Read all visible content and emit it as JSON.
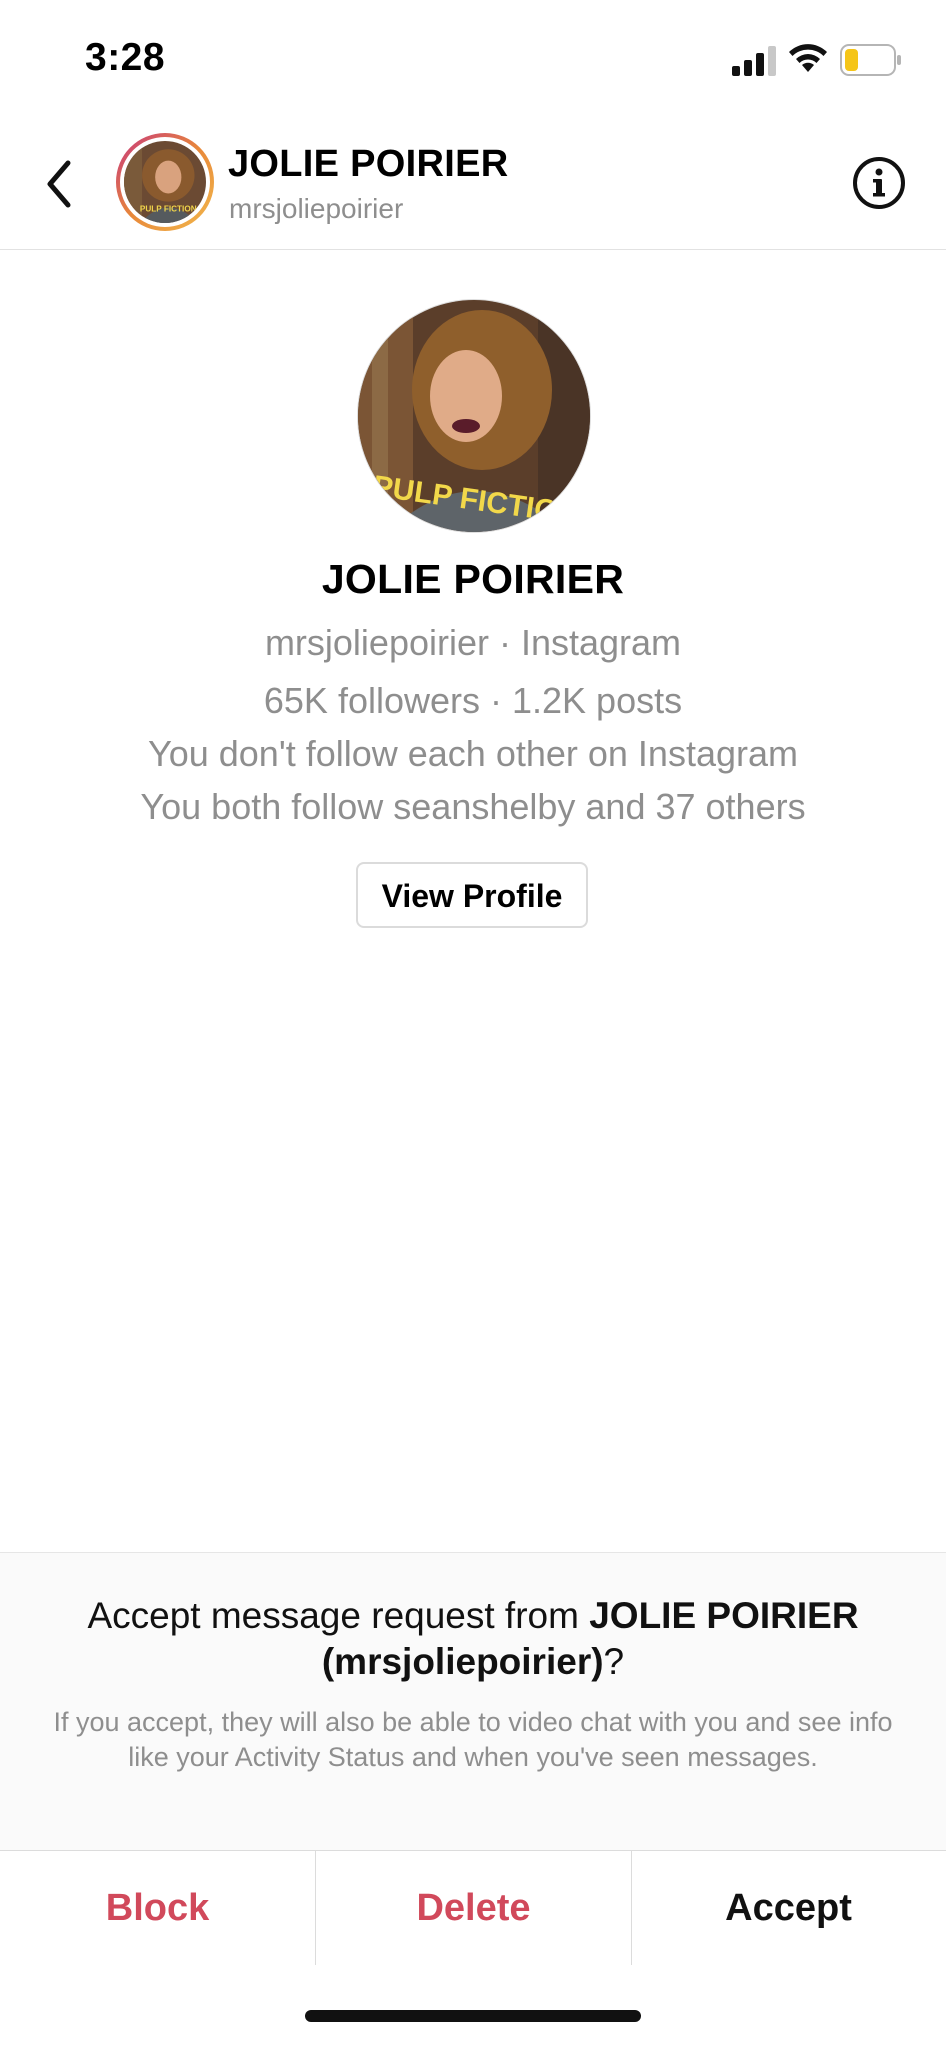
{
  "status_bar": {
    "time": "3:28",
    "icons": [
      "signal-icon",
      "wifi-icon",
      "battery-icon"
    ]
  },
  "header": {
    "name": "JOLIE POIRIER",
    "username": "mrsjoliepoirier",
    "icons": [
      "chevron-left-icon",
      "info-icon"
    ]
  },
  "profile": {
    "name": "JOLIE POIRIER",
    "source_line": "mrsjoliepoirier · Instagram",
    "stats_line": "65K followers · 1.2K posts",
    "follow_line": "You don't follow each other on Instagram",
    "mutual_line": "You both follow seanshelby and 37 others",
    "view_profile_label": "View Profile",
    "avatar_shirt_text": "PULP FICTION"
  },
  "request": {
    "title_prefix": "Accept message request from ",
    "title_name": "JOLIE POIRIER",
    "title_username": "(mrsjoliepoirier)",
    "title_suffix": "?",
    "description": "If you accept, they will also be able to video chat with you and see info like your Activity Status and when you've seen messages."
  },
  "actions": {
    "block": "Block",
    "delete": "Delete",
    "accept": "Accept"
  },
  "colors": {
    "destructive": "#d1495b",
    "secondary_text": "#8e8e8e",
    "story_ring": [
      "#c6367f",
      "#e8883a",
      "#f2b94c"
    ]
  }
}
